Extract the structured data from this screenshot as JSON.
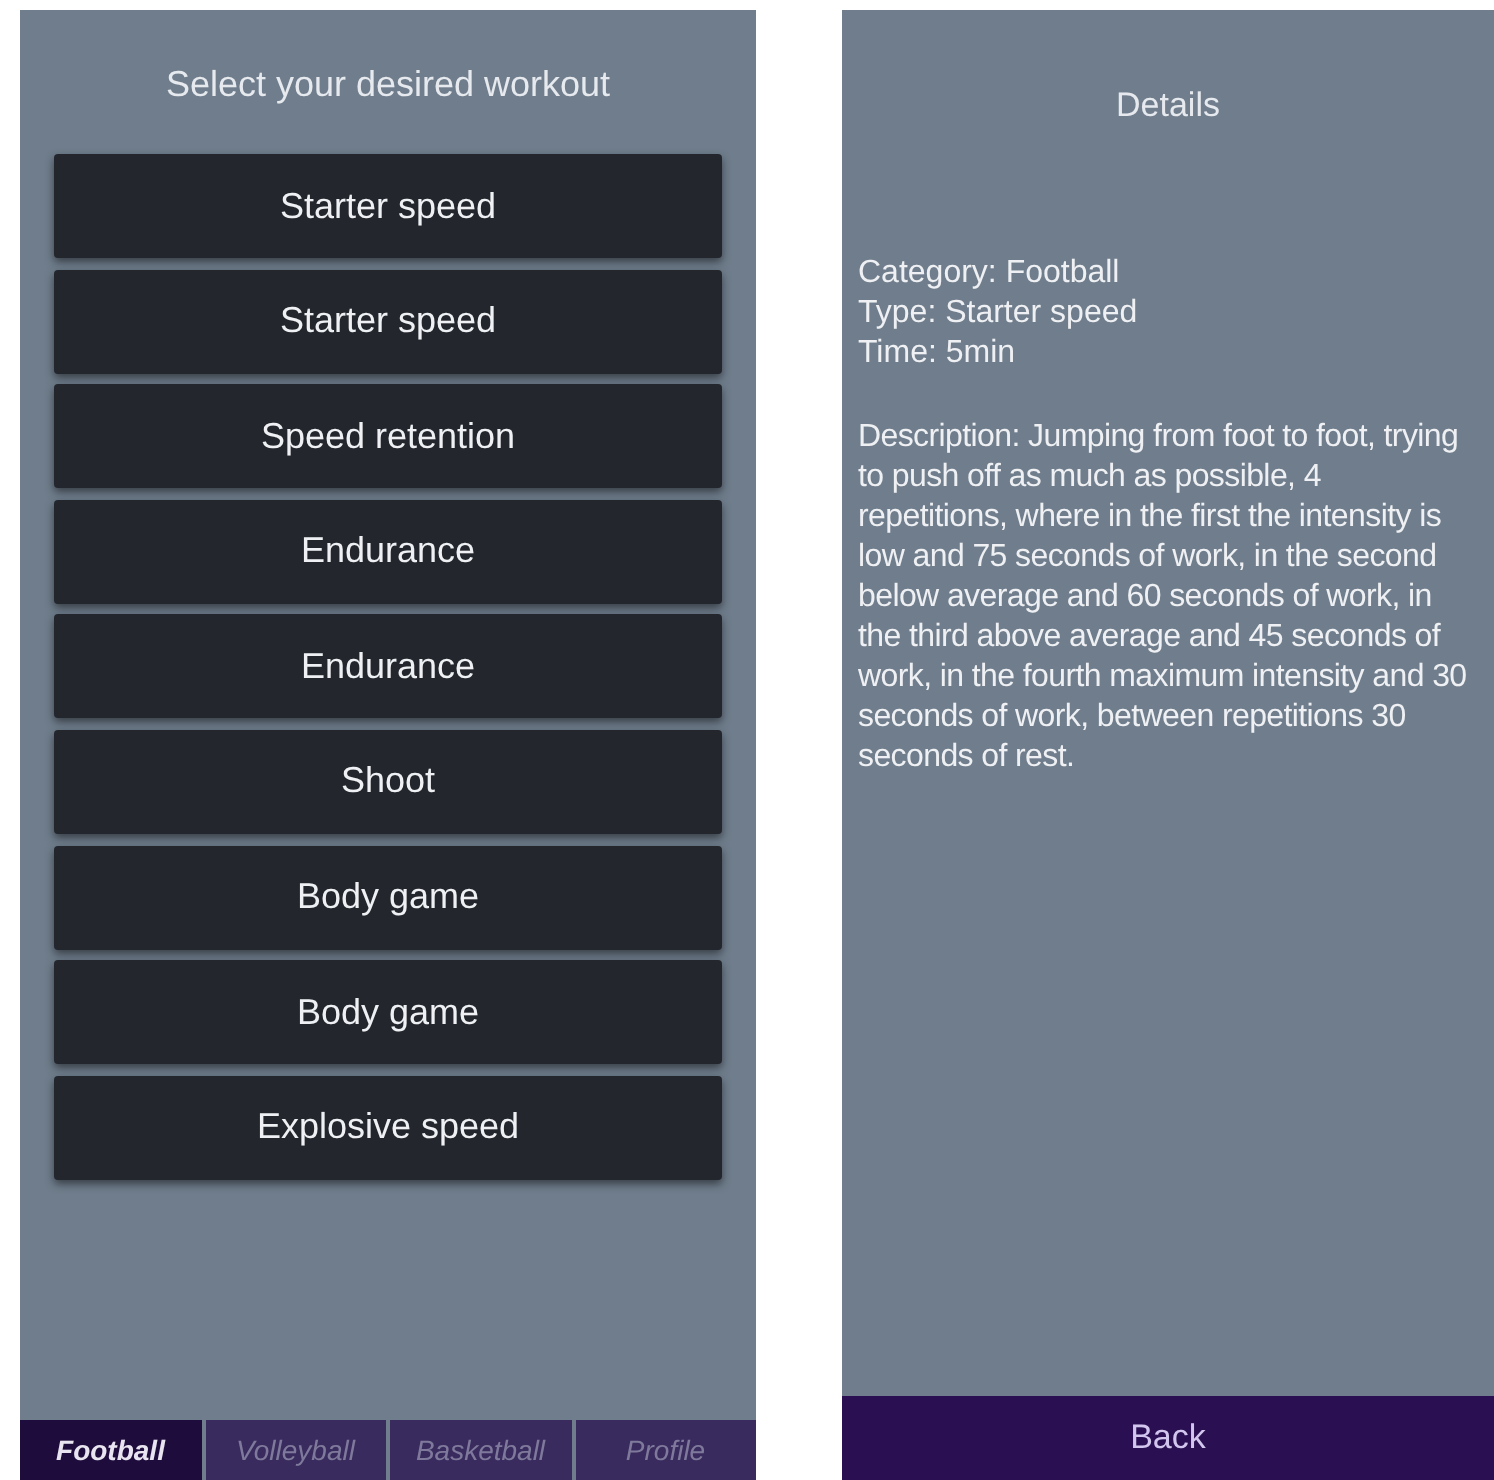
{
  "workout_list": {
    "title": "Select your desired workout",
    "items": [
      {
        "label": "Starter speed"
      },
      {
        "label": "Starter speed"
      },
      {
        "label": "Speed retention"
      },
      {
        "label": "Endurance"
      },
      {
        "label": "Endurance"
      },
      {
        "label": "Shoot"
      },
      {
        "label": "Body game"
      },
      {
        "label": "Body game"
      },
      {
        "label": "Explosive speed"
      }
    ]
  },
  "tabs": [
    {
      "label": "Football",
      "selected": true
    },
    {
      "label": "Volleyball",
      "selected": false
    },
    {
      "label": "Basketball",
      "selected": false
    },
    {
      "label": "Profile",
      "selected": false
    }
  ],
  "details": {
    "title": "Details",
    "lines": [
      "Category: Football",
      "Type: Starter speed",
      "Time: 5min"
    ],
    "description": "Description: Jumping from foot to foot, trying to push off as much as possible, 4 repetitions, where in the first the intensity is low and 75 seconds of work, in the second below average and 60 seconds of work, in the third above average and 45 seconds of work, in the fourth maximum intensity and 30 seconds of work, between repetitions 30 seconds of rest.",
    "back_button": "Back"
  }
}
